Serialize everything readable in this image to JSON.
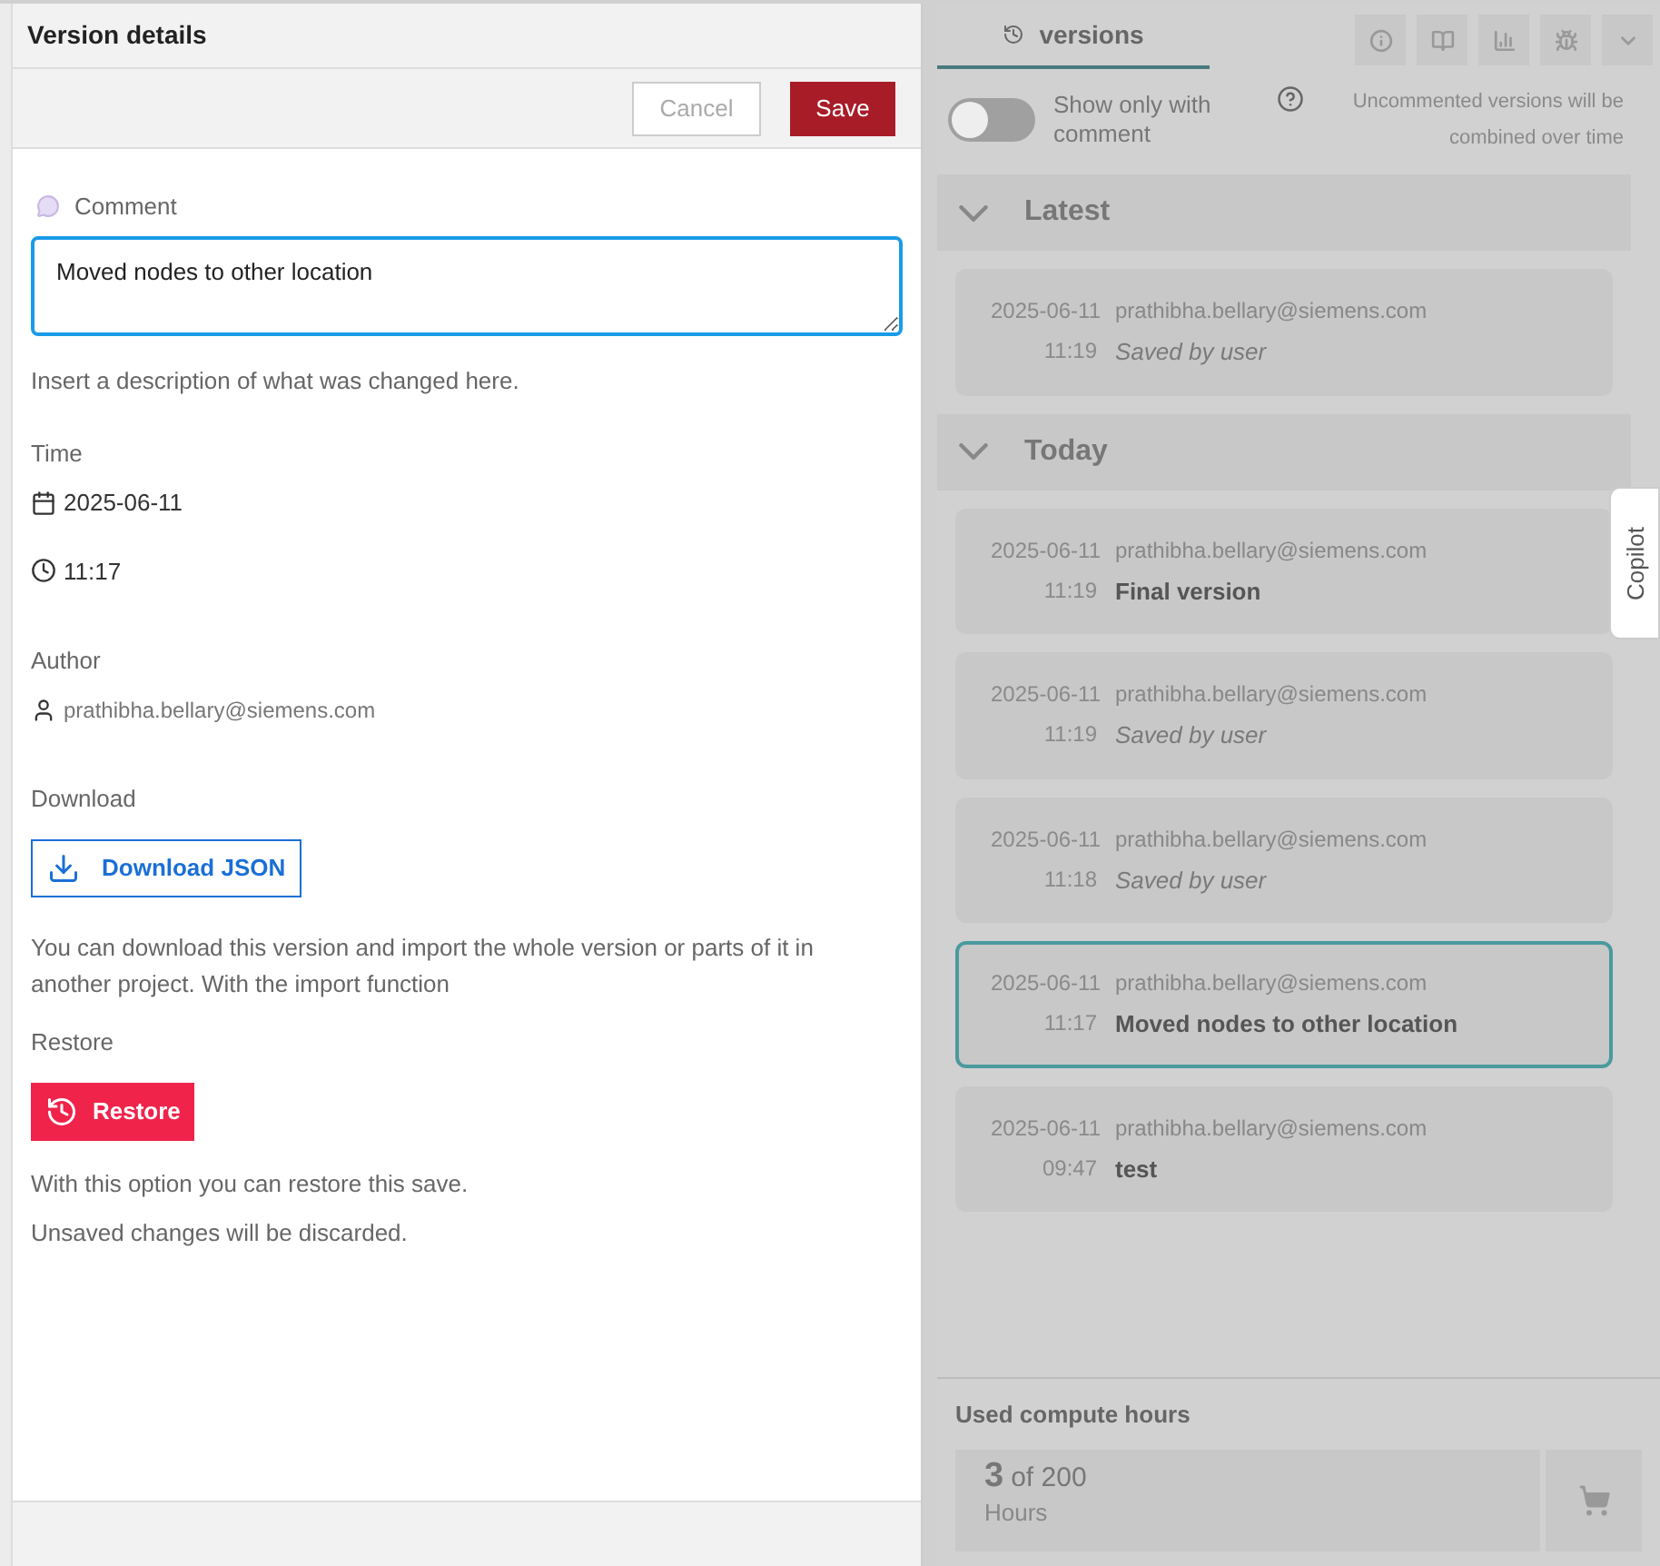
{
  "details": {
    "title": "Version details",
    "cancel": "Cancel",
    "save": "Save",
    "comment_label": "Comment",
    "comment_value": "Moved nodes to other location",
    "comment_hint": "Insert a description of what was changed here.",
    "time_label": "Time",
    "date": "2025-06-11",
    "time": "11:17",
    "author_label": "Author",
    "author": "prathibha.bellary@siemens.com",
    "download_label": "Download",
    "download_button": "Download JSON",
    "download_text": "You can download this version and import the whole version or parts of it in another project. With the import function",
    "restore_label": "Restore",
    "restore_button": "Restore",
    "restore_text": [
      "With this option you can restore this save.",
      "Unsaved changes will be discarded."
    ]
  },
  "versions": {
    "tabs": [
      {
        "label": "versions",
        "selected": true
      }
    ],
    "toggle": {
      "label": "Show only with comment",
      "on": false
    },
    "hint": "Uncommented versions will be combined over time",
    "groups": [
      {
        "title": "Latest",
        "expanded": true,
        "items": [
          {
            "date": "2025-06-11",
            "time": "11:19",
            "author": "prathibha.bellary@siemens.com",
            "comment": "Saved by user",
            "kind": "auto",
            "selected": false
          }
        ]
      },
      {
        "title": "Today",
        "expanded": true,
        "items": [
          {
            "date": "2025-06-11",
            "time": "11:19",
            "author": "prathibha.bellary@siemens.com",
            "comment": "Final version",
            "kind": "named",
            "selected": false
          },
          {
            "date": "2025-06-11",
            "time": "11:19",
            "author": "prathibha.bellary@siemens.com",
            "comment": "Saved by user",
            "kind": "auto",
            "selected": false
          },
          {
            "date": "2025-06-11",
            "time": "11:18",
            "author": "prathibha.bellary@siemens.com",
            "comment": "Saved by user",
            "kind": "auto",
            "selected": false
          },
          {
            "date": "2025-06-11",
            "time": "11:17",
            "author": "prathibha.bellary@siemens.com",
            "comment": "Moved nodes to other location",
            "kind": "named",
            "selected": true
          },
          {
            "date": "2025-06-11",
            "time": "09:47",
            "author": "prathibha.bellary@siemens.com",
            "comment": "test",
            "kind": "named",
            "selected": false
          }
        ]
      }
    ]
  },
  "copilot": "Copilot",
  "compute": {
    "label": "Used compute hours",
    "used": "3",
    "total": "of 200",
    "unit": "Hours"
  }
}
